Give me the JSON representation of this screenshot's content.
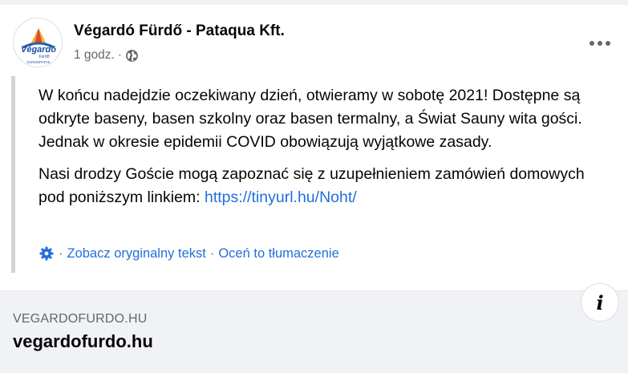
{
  "post": {
    "author": "Végardó Fürdő - Pataqua Kft.",
    "timestamp": "1 godz.",
    "separator": "·",
    "privacy_icon": "globe-icon",
    "more_icon": "more-horizontal-icon",
    "paragraphs": [
      "W końcu nadejdzie oczekiwany dzień, otwieramy w sobotę 2021! Dostępne są odkryte baseny, basen szkolny oraz basen termalny, a Świat Sauny wita gości. Jednak w okresie epidemii COVID obowiązują wyjątkowe zasady."
    ],
    "paragraph2_text": "Nasi drodzy Goście mogą zapoznać się z uzupełnieniem zamówień domowych pod poniższym linkiem: ",
    "paragraph2_link": "https://tinyurl.hu/Noht/"
  },
  "translation": {
    "icon": "gear-icon",
    "separator": "·",
    "see_original": "Zobacz oryginalny tekst",
    "rate": "Oceń to tłumaczenie"
  },
  "avatar": {
    "logo_text": "Végardó",
    "logo_subtext": "Fürdő",
    "logo_footer": "SÁROSPATAK"
  },
  "link_preview": {
    "caption": "VEGARDOFURDO.HU",
    "title": "vegardofurdo.hu",
    "info_icon": "info-icon",
    "info_glyph": "i"
  },
  "colors": {
    "link": "#216fdb",
    "secondary_text": "#65676b",
    "quote_border": "#cfd3d8",
    "preview_bg": "#f0f2f5"
  }
}
